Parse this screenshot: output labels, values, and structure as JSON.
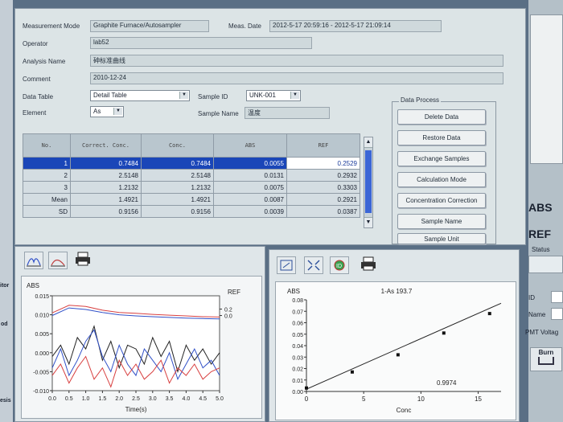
{
  "info": {
    "mode_label": "Measurement Mode",
    "mode_value": "Graphite Furnace/Autosampler",
    "date_label": "Meas. Date",
    "date_value": "2012-5-17 20:59:16 - 2012-5-17 21:09:14",
    "operator_label": "Operator",
    "operator_value": "lab52",
    "analysis_label": "Analysis Name",
    "analysis_value": "砷标准曲线",
    "comment_label": "Comment",
    "comment_value": "2010-12-24",
    "datatable_label": "Data Table",
    "datatable_value": "Detail Table",
    "sampleid_label": "Sample ID",
    "sampleid_value": "UNK-001",
    "element_label": "Element",
    "element_value": "As",
    "samplename_label": "Sample Name",
    "samplename_value": "温度"
  },
  "table": {
    "headers": [
      "No.",
      "Correct. Conc.",
      "Conc.",
      "ABS",
      "REF"
    ],
    "rows": [
      [
        "1",
        "0.7484",
        "0.7484",
        "0.0055",
        "0.2529"
      ],
      [
        "2",
        "2.5148",
        "2.5148",
        "0.0131",
        "0.2932"
      ],
      [
        "3",
        "1.2132",
        "1.2132",
        "0.0075",
        "0.3303"
      ],
      [
        "Mean",
        "1.4921",
        "1.4921",
        "0.0087",
        "0.2921"
      ],
      [
        "SD",
        "0.9156",
        "0.9156",
        "0.0039",
        "0.0387"
      ]
    ]
  },
  "process": {
    "title": "Data Process",
    "buttons": [
      "Delete Data",
      "Restore Data",
      "Exchange Samples",
      "Calculation Mode",
      "Concentration Correction",
      "Sample Name",
      "Sample Unit"
    ]
  },
  "right_panel": {
    "abs": "ABS",
    "ref": "REF",
    "status": "Status",
    "id": "ID",
    "name": "Name",
    "pmt": "PMT Voltag",
    "burn": "Burn"
  },
  "left_strip": [
    "itor",
    "od",
    "esis"
  ],
  "chart_data": [
    {
      "type": "line",
      "title": "",
      "xlabel": "Time(s)",
      "ylabel": "ABS",
      "y2label": "REF",
      "xlim": [
        0.0,
        5.0
      ],
      "ylim": [
        -0.01,
        0.015
      ],
      "x_ticks": [
        "0.0",
        "0.5",
        "1.0",
        "1.5",
        "2.0",
        "2.5",
        "3.0",
        "3.5",
        "4.0",
        "4.5",
        "5.0"
      ],
      "y_ticks": [
        "0.015",
        "0.010",
        "0.005",
        "0.000",
        "-0.005",
        "-0.010"
      ],
      "y2_ticks": [
        "0.2",
        "0.0"
      ],
      "series": [
        {
          "color": "#d84040",
          "x": [
            0.0,
            0.5,
            1.0,
            1.5,
            2.0,
            2.5,
            3.0,
            3.5,
            4.0,
            4.5,
            5.0
          ],
          "y": [
            0.0105,
            0.0125,
            0.0122,
            0.0112,
            0.0106,
            0.0104,
            0.0101,
            0.0099,
            0.0097,
            0.0095,
            0.0094
          ]
        },
        {
          "color": "#3050c8",
          "x": [
            0.0,
            0.5,
            1.0,
            1.5,
            2.0,
            2.5,
            3.0,
            3.5,
            4.0,
            4.5,
            5.0
          ],
          "y": [
            0.0098,
            0.0118,
            0.0114,
            0.0106,
            0.01,
            0.0097,
            0.0095,
            0.0093,
            0.0091,
            0.009,
            0.0089
          ]
        },
        {
          "color": "#222222",
          "x": [
            0.0,
            0.25,
            0.5,
            0.75,
            1.0,
            1.25,
            1.5,
            1.75,
            2.0,
            2.25,
            2.5,
            2.75,
            3.0,
            3.25,
            3.5,
            3.75,
            4.0,
            4.25,
            4.5,
            4.75,
            5.0
          ],
          "y": [
            -0.001,
            0.002,
            -0.003,
            0.004,
            0.001,
            0.007,
            -0.002,
            0.003,
            -0.004,
            0.002,
            0.001,
            -0.003,
            0.004,
            -0.001,
            0.003,
            -0.005,
            0.002,
            -0.002,
            0.001,
            -0.003,
            0.0
          ]
        },
        {
          "color": "#3050c8",
          "x": [
            0.0,
            0.25,
            0.5,
            0.75,
            1.0,
            1.25,
            1.5,
            1.75,
            2.0,
            2.25,
            2.5,
            2.75,
            3.0,
            3.25,
            3.5,
            3.75,
            4.0,
            4.25,
            4.5,
            4.75,
            5.0
          ],
          "y": [
            -0.004,
            0.001,
            -0.006,
            -0.002,
            0.003,
            0.006,
            -0.001,
            -0.005,
            0.002,
            -0.003,
            -0.006,
            0.001,
            -0.002,
            -0.005,
            0.0,
            -0.007,
            -0.003,
            0.001,
            -0.004,
            -0.002,
            -0.006
          ]
        },
        {
          "color": "#d84040",
          "x": [
            0.0,
            0.25,
            0.5,
            0.75,
            1.0,
            1.25,
            1.5,
            1.75,
            2.0,
            2.25,
            2.5,
            2.75,
            3.0,
            3.25,
            3.5,
            3.75,
            4.0,
            4.25,
            4.5,
            4.75,
            5.0
          ],
          "y": [
            -0.006,
            -0.003,
            -0.008,
            -0.004,
            -0.001,
            -0.007,
            -0.004,
            -0.009,
            -0.002,
            -0.006,
            -0.003,
            -0.007,
            -0.005,
            -0.002,
            -0.008,
            -0.004,
            -0.006,
            -0.003,
            -0.007,
            -0.005,
            -0.004
          ]
        }
      ]
    },
    {
      "type": "scatter",
      "title": "1-As 193.7",
      "xlabel": "Conc",
      "ylabel": "ABS",
      "xlim": [
        0,
        17
      ],
      "ylim": [
        0,
        0.08
      ],
      "x_ticks": [
        "0",
        "5",
        "10",
        "15"
      ],
      "y_ticks": [
        "0.08",
        "0.07",
        "0.06",
        "0.05",
        "0.04",
        "0.03",
        "0.02",
        "0.01",
        "0.00"
      ],
      "points": [
        {
          "x": 0,
          "y": 0.003
        },
        {
          "x": 4,
          "y": 0.017
        },
        {
          "x": 8,
          "y": 0.032
        },
        {
          "x": 12,
          "y": 0.051
        },
        {
          "x": 16,
          "y": 0.068
        }
      ],
      "fit": {
        "x": [
          0,
          17.5
        ],
        "y": [
          0.002,
          0.077
        ]
      },
      "r_value": "0.9974"
    }
  ]
}
